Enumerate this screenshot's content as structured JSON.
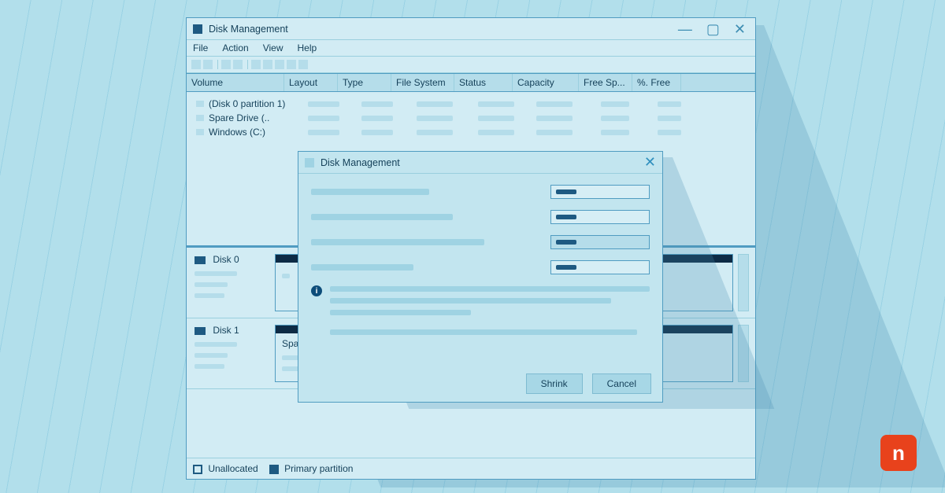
{
  "window": {
    "title": "Disk Management",
    "menubar": [
      "File",
      "Action",
      "View",
      "Help"
    ],
    "columns": {
      "volume": "Volume",
      "layout": "Layout",
      "type": "Type",
      "filesystem": "File System",
      "status": "Status",
      "capacity": "Capacity",
      "free_space": "Free Sp...",
      "pct_free": "%. Free"
    },
    "volumes": [
      {
        "name": "(Disk 0 partition 1)"
      },
      {
        "name": "Spare Drive (.."
      },
      {
        "name": "Windows (C:)"
      }
    ],
    "disks": [
      {
        "label": "Disk 0"
      },
      {
        "label": "Disk 1",
        "partition_label": "Spare Drive (D:)"
      }
    ],
    "legend": {
      "unallocated": "Unallocated",
      "primary": "Primary partition"
    }
  },
  "dialog": {
    "title": "Disk Management",
    "info_glyph": "i",
    "actions": {
      "shrink": "Shrink",
      "cancel": "Cancel"
    }
  },
  "logo_glyph": "n"
}
